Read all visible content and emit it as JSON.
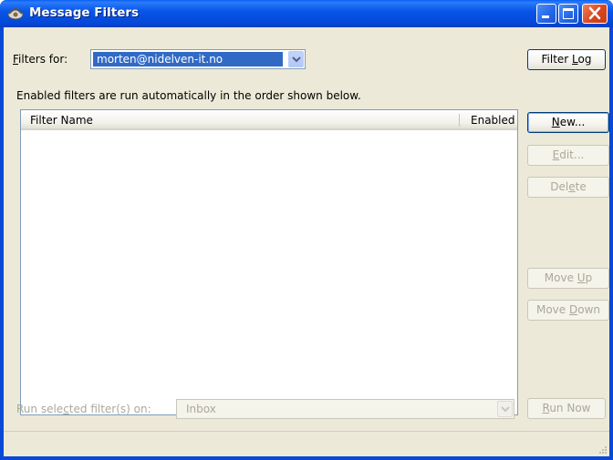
{
  "window": {
    "title": "Message Filters",
    "icon": "thunderbird-filter-icon"
  },
  "titlebar_buttons": {
    "minimize_icon": "minimize-icon",
    "maximize_icon": "maximize-icon",
    "close_icon": "close-icon"
  },
  "filters_for": {
    "label_accel": "F",
    "label_rest": "ilters for:",
    "selected_account": "morten@nidelven-it.no"
  },
  "buttons": {
    "filter_log_pre": "Filter ",
    "filter_log_accel": "L",
    "filter_log_post": "og",
    "new_accel": "N",
    "new_post": "ew...",
    "edit_accel": "E",
    "edit_post": "dit...",
    "delete_pre": "Del",
    "delete_accel": "e",
    "delete_post": "te",
    "move_up_pre": "Move ",
    "move_up_accel": "U",
    "move_up_post": "p",
    "move_down_pre": "Move ",
    "move_down_accel": "D",
    "move_down_post": "own",
    "run_now_accel": "R",
    "run_now_post": "un Now"
  },
  "info_text": "Enabled filters are run automatically in the order shown below.",
  "filter_list": {
    "columns": [
      "Filter Name",
      "Enabled"
    ],
    "rows": []
  },
  "run_on": {
    "label_pre": "Run sele",
    "label_accel": "c",
    "label_post": "ted filter(s) on:",
    "folder": "Inbox"
  },
  "colors": {
    "titlebar": "#0856e8",
    "selection": "#316ac5",
    "dialog_bg": "#ece9d8",
    "disabled_text": "#aca899"
  }
}
